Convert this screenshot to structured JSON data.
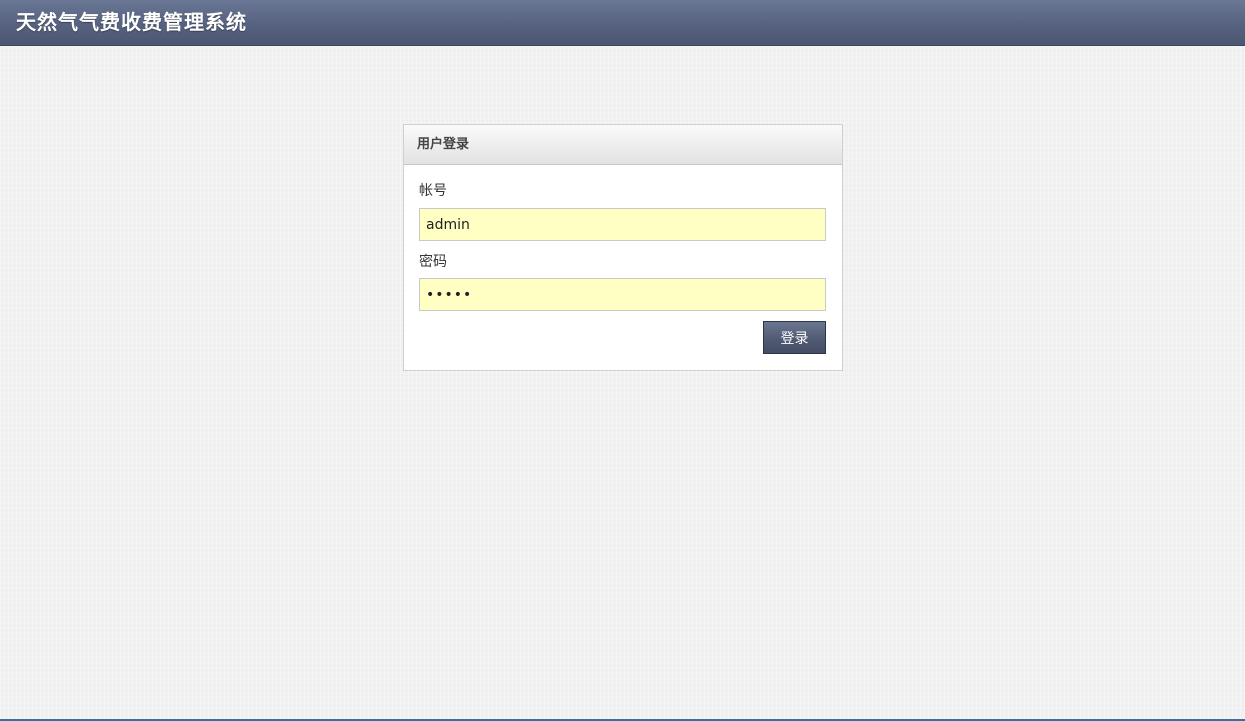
{
  "header": {
    "app_title": "天然气气费收费管理系统"
  },
  "login": {
    "panel_title": "用户登录",
    "account_label": "帐号",
    "account_value": "admin",
    "password_label": "密码",
    "password_value": "•••••",
    "submit_label": "登录"
  },
  "colors": {
    "header_bar": "#56627f",
    "input_background": "#ffffc3",
    "button": "#515b74"
  }
}
